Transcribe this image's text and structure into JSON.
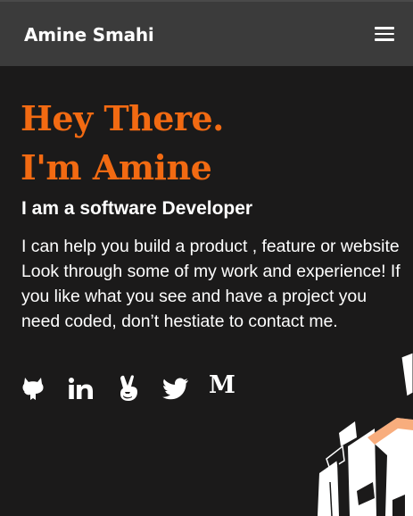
{
  "header": {
    "brand": "Amine Smahi",
    "menu_icon": "hamburger-menu-icon"
  },
  "hero": {
    "greeting": "Hey There.",
    "name_line": "I'm Amine",
    "subtitle": "I am a software Developer",
    "description": "I can help you build a product , feature or website Look through some of my work and experience! If you like what you see and have a project you need coded, don’t hestiate to contact me."
  },
  "socials": [
    {
      "icon": "github-icon"
    },
    {
      "icon": "linkedin-icon"
    },
    {
      "icon": "angellist-icon"
    },
    {
      "icon": "twitter-icon"
    },
    {
      "icon": "medium-icon",
      "glyph": "M"
    }
  ],
  "colors": {
    "accent": "#f26a12",
    "background": "#1b1a1a",
    "header": "#3b3b3b",
    "text": "#ffffff"
  }
}
